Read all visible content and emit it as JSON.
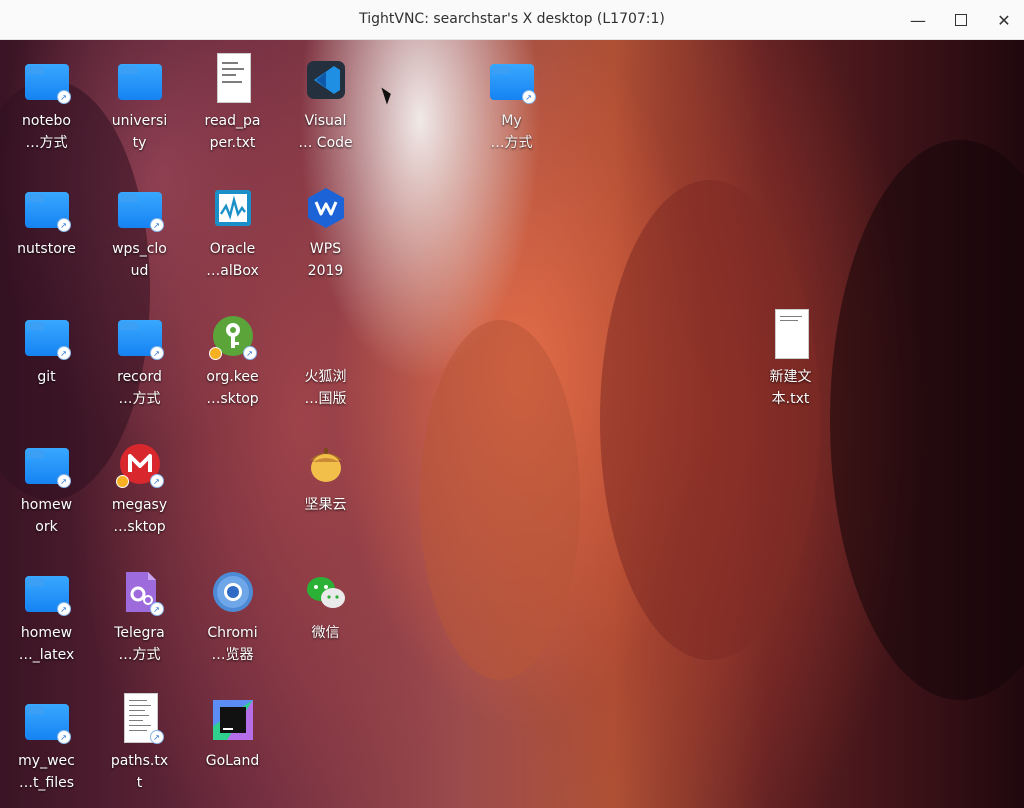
{
  "window": {
    "title": "TightVNC: searchstar's X desktop (L1707:1)",
    "minimize_icon": "minimize-icon",
    "maximize_icon": "maximize-icon",
    "close_icon": "close-icon"
  },
  "desktop": {
    "icons": [
      {
        "label": "notebo\n…方式",
        "type": "folder-link"
      },
      {
        "label": "universi\nty",
        "type": "folder"
      },
      {
        "label": "read_pa\nper.txt",
        "type": "text-file"
      },
      {
        "label": "Visual\n… Code",
        "type": "vscode"
      },
      {
        "label": "My\n…方式",
        "type": "folder-link"
      },
      {
        "label": "nutstore",
        "type": "folder-link"
      },
      {
        "label": "wps_clo\nud",
        "type": "folder-link"
      },
      {
        "label": "Oracle\n…alBox",
        "type": "virtualbox"
      },
      {
        "label": "WPS\n2019",
        "type": "wps"
      },
      {
        "label": "git",
        "type": "folder-link"
      },
      {
        "label": "record\n…方式",
        "type": "folder-link"
      },
      {
        "label": "org.kee\n…sktop",
        "type": "keepass"
      },
      {
        "label": "火狐浏\n…国版",
        "type": "firefox"
      },
      {
        "label": "新建文\n本.txt",
        "type": "text-file"
      },
      {
        "label": "homew\nork",
        "type": "folder-link"
      },
      {
        "label": "megasy\n…sktop",
        "type": "mega"
      },
      {
        "label": "坚果云",
        "type": "nutstore-app"
      },
      {
        "label": "homew\n…_latex",
        "type": "folder-link"
      },
      {
        "label": "Telegra\n…方式",
        "type": "telegram-link"
      },
      {
        "label": "Chromi\n…览器",
        "type": "chromium"
      },
      {
        "label": "微信",
        "type": "wechat"
      },
      {
        "label": "my_wec\n…t_files",
        "type": "folder-link"
      },
      {
        "label": "paths.tx\nt",
        "type": "text-file"
      },
      {
        "label": "GoLand",
        "type": "goland"
      }
    ]
  }
}
